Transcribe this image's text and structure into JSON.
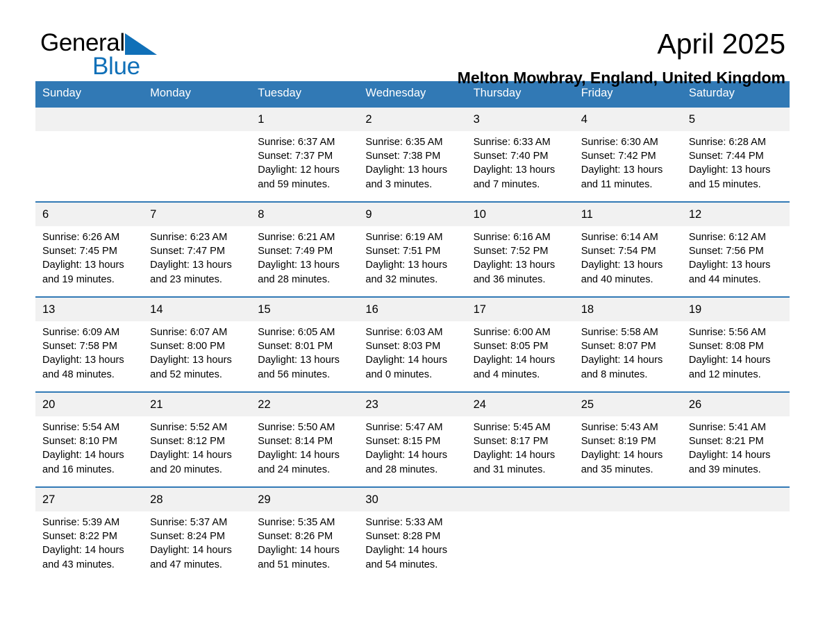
{
  "brand": {
    "word1": "General",
    "word2": "Blue",
    "triangle_color": "#1070b8",
    "text_color": "#000000"
  },
  "header": {
    "title": "April 2025",
    "location": "Melton Mowbray, England, United Kingdom"
  },
  "theme": {
    "header_bg": "#3179b5",
    "header_text": "#ffffff",
    "daynum_bg": "#f1f1f1",
    "row_border": "#3179b5"
  },
  "calendar": {
    "weekday_headers": [
      "Sunday",
      "Monday",
      "Tuesday",
      "Wednesday",
      "Thursday",
      "Friday",
      "Saturday"
    ],
    "weeks": [
      [
        {
          "empty": true
        },
        {
          "empty": true
        },
        {
          "day": "1",
          "sunrise": "Sunrise: 6:37 AM",
          "sunset": "Sunset: 7:37 PM",
          "daylight1": "Daylight: 12 hours",
          "daylight2": "and 59 minutes."
        },
        {
          "day": "2",
          "sunrise": "Sunrise: 6:35 AM",
          "sunset": "Sunset: 7:38 PM",
          "daylight1": "Daylight: 13 hours",
          "daylight2": "and 3 minutes."
        },
        {
          "day": "3",
          "sunrise": "Sunrise: 6:33 AM",
          "sunset": "Sunset: 7:40 PM",
          "daylight1": "Daylight: 13 hours",
          "daylight2": "and 7 minutes."
        },
        {
          "day": "4",
          "sunrise": "Sunrise: 6:30 AM",
          "sunset": "Sunset: 7:42 PM",
          "daylight1": "Daylight: 13 hours",
          "daylight2": "and 11 minutes."
        },
        {
          "day": "5",
          "sunrise": "Sunrise: 6:28 AM",
          "sunset": "Sunset: 7:44 PM",
          "daylight1": "Daylight: 13 hours",
          "daylight2": "and 15 minutes."
        }
      ],
      [
        {
          "day": "6",
          "sunrise": "Sunrise: 6:26 AM",
          "sunset": "Sunset: 7:45 PM",
          "daylight1": "Daylight: 13 hours",
          "daylight2": "and 19 minutes."
        },
        {
          "day": "7",
          "sunrise": "Sunrise: 6:23 AM",
          "sunset": "Sunset: 7:47 PM",
          "daylight1": "Daylight: 13 hours",
          "daylight2": "and 23 minutes."
        },
        {
          "day": "8",
          "sunrise": "Sunrise: 6:21 AM",
          "sunset": "Sunset: 7:49 PM",
          "daylight1": "Daylight: 13 hours",
          "daylight2": "and 28 minutes."
        },
        {
          "day": "9",
          "sunrise": "Sunrise: 6:19 AM",
          "sunset": "Sunset: 7:51 PM",
          "daylight1": "Daylight: 13 hours",
          "daylight2": "and 32 minutes."
        },
        {
          "day": "10",
          "sunrise": "Sunrise: 6:16 AM",
          "sunset": "Sunset: 7:52 PM",
          "daylight1": "Daylight: 13 hours",
          "daylight2": "and 36 minutes."
        },
        {
          "day": "11",
          "sunrise": "Sunrise: 6:14 AM",
          "sunset": "Sunset: 7:54 PM",
          "daylight1": "Daylight: 13 hours",
          "daylight2": "and 40 minutes."
        },
        {
          "day": "12",
          "sunrise": "Sunrise: 6:12 AM",
          "sunset": "Sunset: 7:56 PM",
          "daylight1": "Daylight: 13 hours",
          "daylight2": "and 44 minutes."
        }
      ],
      [
        {
          "day": "13",
          "sunrise": "Sunrise: 6:09 AM",
          "sunset": "Sunset: 7:58 PM",
          "daylight1": "Daylight: 13 hours",
          "daylight2": "and 48 minutes."
        },
        {
          "day": "14",
          "sunrise": "Sunrise: 6:07 AM",
          "sunset": "Sunset: 8:00 PM",
          "daylight1": "Daylight: 13 hours",
          "daylight2": "and 52 minutes."
        },
        {
          "day": "15",
          "sunrise": "Sunrise: 6:05 AM",
          "sunset": "Sunset: 8:01 PM",
          "daylight1": "Daylight: 13 hours",
          "daylight2": "and 56 minutes."
        },
        {
          "day": "16",
          "sunrise": "Sunrise: 6:03 AM",
          "sunset": "Sunset: 8:03 PM",
          "daylight1": "Daylight: 14 hours",
          "daylight2": "and 0 minutes."
        },
        {
          "day": "17",
          "sunrise": "Sunrise: 6:00 AM",
          "sunset": "Sunset: 8:05 PM",
          "daylight1": "Daylight: 14 hours",
          "daylight2": "and 4 minutes."
        },
        {
          "day": "18",
          "sunrise": "Sunrise: 5:58 AM",
          "sunset": "Sunset: 8:07 PM",
          "daylight1": "Daylight: 14 hours",
          "daylight2": "and 8 minutes."
        },
        {
          "day": "19",
          "sunrise": "Sunrise: 5:56 AM",
          "sunset": "Sunset: 8:08 PM",
          "daylight1": "Daylight: 14 hours",
          "daylight2": "and 12 minutes."
        }
      ],
      [
        {
          "day": "20",
          "sunrise": "Sunrise: 5:54 AM",
          "sunset": "Sunset: 8:10 PM",
          "daylight1": "Daylight: 14 hours",
          "daylight2": "and 16 minutes."
        },
        {
          "day": "21",
          "sunrise": "Sunrise: 5:52 AM",
          "sunset": "Sunset: 8:12 PM",
          "daylight1": "Daylight: 14 hours",
          "daylight2": "and 20 minutes."
        },
        {
          "day": "22",
          "sunrise": "Sunrise: 5:50 AM",
          "sunset": "Sunset: 8:14 PM",
          "daylight1": "Daylight: 14 hours",
          "daylight2": "and 24 minutes."
        },
        {
          "day": "23",
          "sunrise": "Sunrise: 5:47 AM",
          "sunset": "Sunset: 8:15 PM",
          "daylight1": "Daylight: 14 hours",
          "daylight2": "and 28 minutes."
        },
        {
          "day": "24",
          "sunrise": "Sunrise: 5:45 AM",
          "sunset": "Sunset: 8:17 PM",
          "daylight1": "Daylight: 14 hours",
          "daylight2": "and 31 minutes."
        },
        {
          "day": "25",
          "sunrise": "Sunrise: 5:43 AM",
          "sunset": "Sunset: 8:19 PM",
          "daylight1": "Daylight: 14 hours",
          "daylight2": "and 35 minutes."
        },
        {
          "day": "26",
          "sunrise": "Sunrise: 5:41 AM",
          "sunset": "Sunset: 8:21 PM",
          "daylight1": "Daylight: 14 hours",
          "daylight2": "and 39 minutes."
        }
      ],
      [
        {
          "day": "27",
          "sunrise": "Sunrise: 5:39 AM",
          "sunset": "Sunset: 8:22 PM",
          "daylight1": "Daylight: 14 hours",
          "daylight2": "and 43 minutes."
        },
        {
          "day": "28",
          "sunrise": "Sunrise: 5:37 AM",
          "sunset": "Sunset: 8:24 PM",
          "daylight1": "Daylight: 14 hours",
          "daylight2": "and 47 minutes."
        },
        {
          "day": "29",
          "sunrise": "Sunrise: 5:35 AM",
          "sunset": "Sunset: 8:26 PM",
          "daylight1": "Daylight: 14 hours",
          "daylight2": "and 51 minutes."
        },
        {
          "day": "30",
          "sunrise": "Sunrise: 5:33 AM",
          "sunset": "Sunset: 8:28 PM",
          "daylight1": "Daylight: 14 hours",
          "daylight2": "and 54 minutes."
        },
        {
          "empty": true
        },
        {
          "empty": true
        },
        {
          "empty": true
        }
      ]
    ]
  }
}
